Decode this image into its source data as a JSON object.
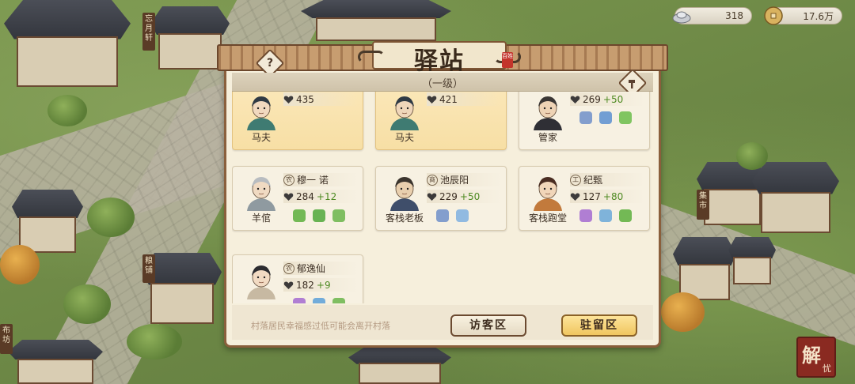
{
  "resources": {
    "silver": {
      "icon": "silver-ingot-icon",
      "value": "318"
    },
    "coin": {
      "icon": "copper-coin-icon",
      "value": "17.6万"
    }
  },
  "panel": {
    "title": "驿站",
    "title_stamp": "百姓",
    "level": "（一级）",
    "help_icon": "question-icon",
    "upgrade_icon": "hammer-icon"
  },
  "cards": [
    {
      "role": "马夫",
      "stat": "435",
      "bonus": "",
      "highlight": true
    },
    {
      "role": "马夫",
      "stat": "421",
      "bonus": "",
      "highlight": true
    },
    {
      "role": "管家",
      "stat": "269",
      "bonus": "+50",
      "highlight": false,
      "skills": [
        "才",
        "scroll",
        "book"
      ]
    },
    {
      "badge": "农",
      "name": "穆一 诺",
      "role": "羊倌",
      "stat": "284",
      "bonus": "+12",
      "highlight": false,
      "skills": [
        "leaf",
        "grass",
        "sprout"
      ]
    },
    {
      "badge": "商",
      "name": "池辰阳",
      "role": "客栈老板",
      "stat": "229",
      "bonus": "+50",
      "highlight": false,
      "skills": [
        "才",
        "cloud"
      ]
    },
    {
      "badge": "工",
      "name": "纪甄",
      "role": "客栈跑堂",
      "stat": "127",
      "bonus": "+80",
      "highlight": false,
      "skills": [
        "gourd",
        "wave",
        "leaf"
      ]
    },
    {
      "badge": "农",
      "name": "郁逸仙",
      "role": "",
      "stat": "182",
      "bonus": "+9",
      "highlight": false,
      "skills": [
        "gourd",
        "flower",
        "sprout"
      ]
    }
  ],
  "footer": {
    "warning": "村落居民幸福感过低可能会离开村落",
    "visitor_button": "访客区",
    "stay_button": "驻留区"
  },
  "seal": {
    "big": "解",
    "small": "忧"
  },
  "colors": {
    "panel_bg": "#f6efdc",
    "frame": "#8a5f3c",
    "highlight_card": "#f7dfa5",
    "bonus_green": "#4e8a22",
    "stay_button": "#f0c660",
    "seal_red": "#8a2a21"
  }
}
